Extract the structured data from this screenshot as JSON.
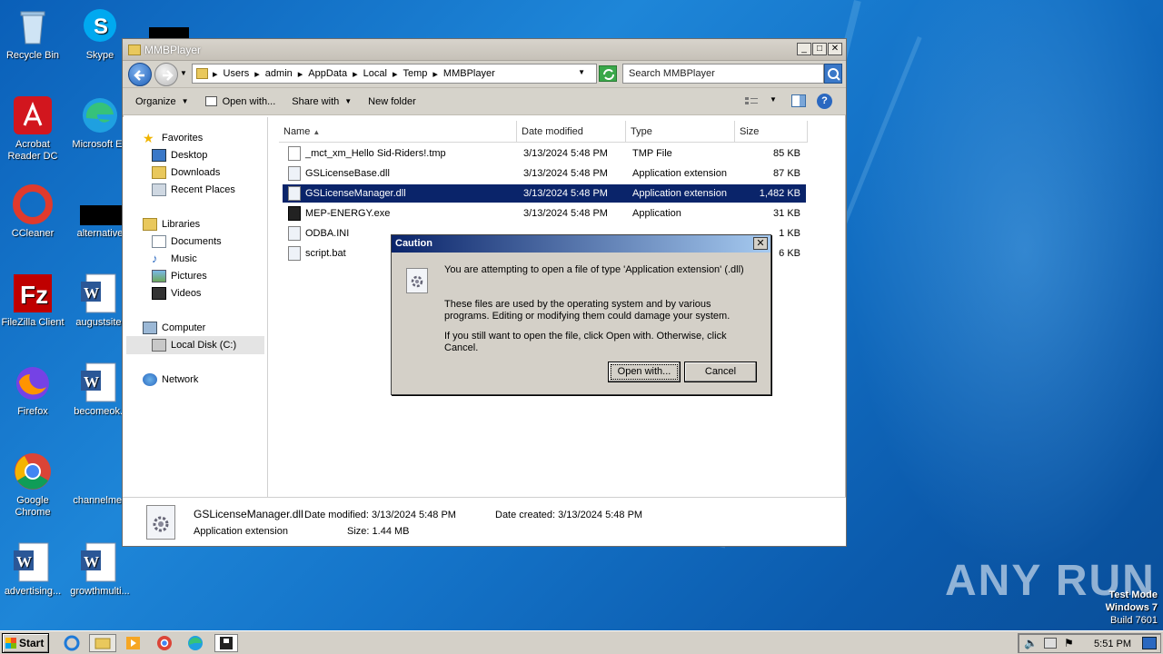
{
  "desktop": {
    "icons": [
      {
        "label": "Recycle Bin"
      },
      {
        "label": "Skype"
      },
      {
        "label": "Acrobat Reader DC"
      },
      {
        "label": "Microsoft Ed"
      },
      {
        "label": "CCleaner"
      },
      {
        "label": "alternative"
      },
      {
        "label": "FileZilla Client"
      },
      {
        "label": "augustsite."
      },
      {
        "label": "Firefox"
      },
      {
        "label": "becomeok.r"
      },
      {
        "label": "Google Chrome"
      },
      {
        "label": "channelmex"
      },
      {
        "label": "advertising..."
      },
      {
        "label": "growthmulti..."
      }
    ]
  },
  "explorer": {
    "title": "MMBPlayer",
    "breadcrumb": [
      "Users",
      "admin",
      "AppData",
      "Local",
      "Temp",
      "MMBPlayer"
    ],
    "search_placeholder": "Search MMBPlayer",
    "toolbar": {
      "organize": "Organize",
      "open_with": "Open with...",
      "share_with": "Share with",
      "new_folder": "New folder"
    },
    "nav": {
      "favorites": "Favorites",
      "desktop": "Desktop",
      "downloads": "Downloads",
      "recent": "Recent Places",
      "libraries": "Libraries",
      "documents": "Documents",
      "music": "Music",
      "pictures": "Pictures",
      "videos": "Videos",
      "computer": "Computer",
      "localdisk": "Local Disk (C:)",
      "network": "Network"
    },
    "columns": {
      "name": "Name",
      "date": "Date modified",
      "type": "Type",
      "size": "Size"
    },
    "files": [
      {
        "name": "_mct_xm_Hello Sid-Riders!.tmp",
        "date": "3/13/2024 5:48 PM",
        "type": "TMP File",
        "size": "85 KB"
      },
      {
        "name": "GSLicenseBase.dll",
        "date": "3/13/2024 5:48 PM",
        "type": "Application extension",
        "size": "87 KB"
      },
      {
        "name": "GSLicenseManager.dll",
        "date": "3/13/2024 5:48 PM",
        "type": "Application extension",
        "size": "1,482 KB"
      },
      {
        "name": "MEP-ENERGY.exe",
        "date": "3/13/2024 5:48 PM",
        "type": "Application",
        "size": "31 KB"
      },
      {
        "name": "ODBA.INI",
        "date": "",
        "type": "",
        "size": "1 KB"
      },
      {
        "name": "script.bat",
        "date": "",
        "type": "",
        "size": "6 KB"
      }
    ],
    "details": {
      "name": "GSLicenseManager.dll",
      "kind": "Application extension",
      "modified_label": "Date modified:",
      "modified": "3/13/2024 5:48 PM",
      "created_label": "Date created:",
      "created": "3/13/2024 5:48 PM",
      "size_label": "Size:",
      "size": "1.44 MB"
    }
  },
  "dialog": {
    "title": "Caution",
    "line1": "You are attempting to open a file of type 'Application extension' (.dll)",
    "line2": "These files are used by the operating system and by various programs. Editing or modifying them could damage your system.",
    "line3": "If you still want to open the file, click Open with. Otherwise, click Cancel.",
    "open_with": "Open with...",
    "cancel": "Cancel"
  },
  "taskbar": {
    "start": "Start",
    "clock": "5:51 PM"
  },
  "watermark": {
    "mode": "Test Mode",
    "os": "Windows 7",
    "build": "Build 7601",
    "brand": "ANY RUN"
  }
}
